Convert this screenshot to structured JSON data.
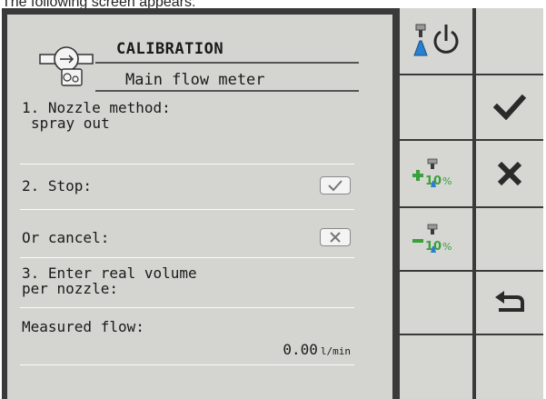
{
  "caption": "The following screen appears:",
  "screen": {
    "title": "CALIBRATION",
    "subtitle": "Main flow meter",
    "step1_label": "1. Nozzle method:",
    "step1_value": "spray out",
    "step2_label": "2. Stop:",
    "cancel_label": "Or cancel:",
    "step3_line1": "3. Enter real volume",
    "step3_line2": "per nozzle:",
    "measured_label": "Measured flow:",
    "measured_value": "0.00",
    "measured_unit": "l/min"
  },
  "softkeys_left": [
    {
      "name": "power-toggle-button",
      "icon": "power-tank-icon"
    },
    {
      "name": "empty-softkey",
      "icon": ""
    },
    {
      "name": "increase-10-percent-button",
      "icon": "plus-10-percent-icon",
      "label": "+10%"
    },
    {
      "name": "decrease-10-percent-button",
      "icon": "minus-10-percent-icon",
      "label": "-10%"
    },
    {
      "name": "empty-softkey",
      "icon": ""
    },
    {
      "name": "empty-softkey",
      "icon": ""
    }
  ],
  "softkeys_right": [
    {
      "name": "empty-softkey",
      "icon": ""
    },
    {
      "name": "confirm-button",
      "icon": "check-icon"
    },
    {
      "name": "cancel-button",
      "icon": "x-icon"
    },
    {
      "name": "empty-softkey",
      "icon": ""
    },
    {
      "name": "back-button",
      "icon": "return-arrow-icon"
    },
    {
      "name": "empty-softkey",
      "icon": ""
    }
  ],
  "colors": {
    "panel": "#d4d4d0",
    "frame": "#3a3a3a",
    "accent_green": "#3aa03a",
    "accent_blue": "#2a7fd0"
  }
}
